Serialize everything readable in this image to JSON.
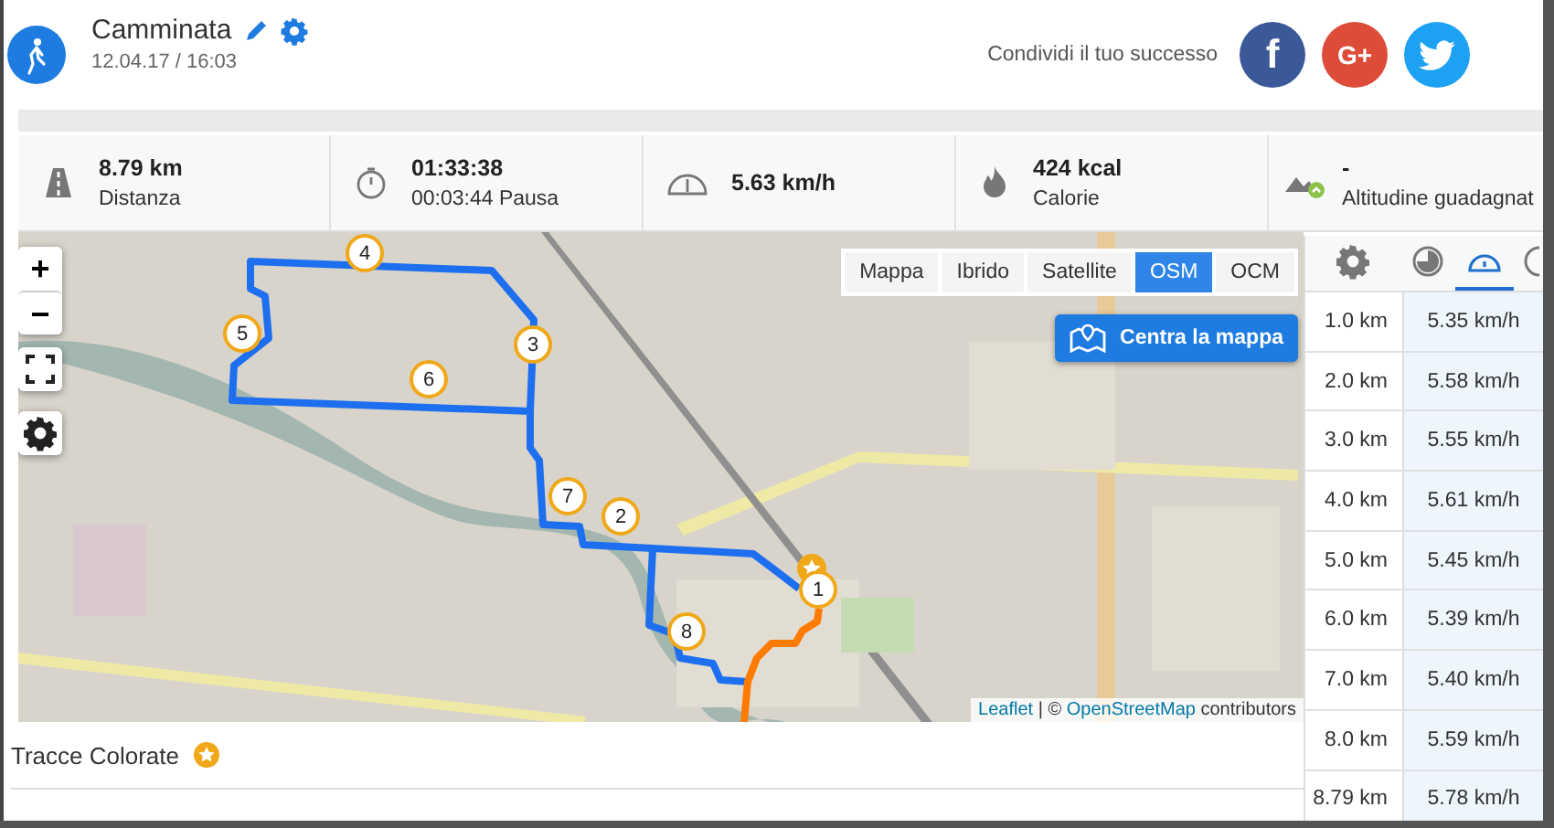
{
  "activity": {
    "title": "Camminata",
    "date": "12.04.17 / 16:03"
  },
  "share": {
    "label": "Condividi il tuo successo",
    "buttons": [
      {
        "kind": "facebook",
        "label": "f"
      },
      {
        "kind": "google",
        "label": "G+"
      },
      {
        "kind": "twitter"
      }
    ]
  },
  "stats": [
    {
      "kind": "distance",
      "value": "8.79 km",
      "label": "Distanza"
    },
    {
      "kind": "time",
      "value": "01:33:38",
      "label": "00:03:44 Pausa"
    },
    {
      "kind": "speed",
      "value": "5.63 km/h"
    },
    {
      "kind": "calories",
      "value": "424 kcal",
      "label": "Calorie"
    },
    {
      "kind": "altitude",
      "value": "-",
      "label": "Altitudine guadagnat"
    }
  ],
  "map": {
    "zoom_in": "+",
    "zoom_out": "−",
    "layers": [
      {
        "label": "Mappa",
        "selected": false
      },
      {
        "label": "Ibrido",
        "selected": false
      },
      {
        "label": "Satellite",
        "selected": false
      },
      {
        "label": "OSM",
        "selected": true
      },
      {
        "label": "OCM",
        "selected": false
      }
    ],
    "center_button": "Centra la mappa",
    "markers": [
      {
        "label": "1"
      },
      {
        "label": "2"
      },
      {
        "label": "3"
      },
      {
        "label": "4"
      },
      {
        "label": "5"
      },
      {
        "label": "6"
      },
      {
        "label": "7"
      },
      {
        "label": "8"
      }
    ],
    "attribution": {
      "link": "Leaflet",
      "separator": "| ©",
      "source": "OpenStreetMap",
      "suffix": "contributors"
    }
  },
  "splits": {
    "tabs": [
      {
        "kind": "settings",
        "selected": false
      },
      {
        "kind": "pace",
        "selected": false
      },
      {
        "kind": "speed",
        "selected": true
      },
      {
        "kind": "time",
        "selected": false
      }
    ],
    "rows": [
      {
        "distance": "1.0 km",
        "speed": "5.35 km/h"
      },
      {
        "distance": "2.0 km",
        "speed": "5.58 km/h"
      },
      {
        "distance": "3.0 km",
        "speed": "5.55 km/h"
      },
      {
        "distance": "4.0 km",
        "speed": "5.61 km/h"
      },
      {
        "distance": "5.0 km",
        "speed": "5.45 km/h"
      },
      {
        "distance": "6.0 km",
        "speed": "5.39 km/h"
      },
      {
        "distance": "7.0 km",
        "speed": "5.40 km/h"
      },
      {
        "distance": "8.0 km",
        "speed": "5.59 km/h"
      },
      {
        "distance": "8.79 km",
        "speed": "5.78 km/h"
      }
    ]
  },
  "tracks": {
    "title": "Tracce Colorate"
  }
}
